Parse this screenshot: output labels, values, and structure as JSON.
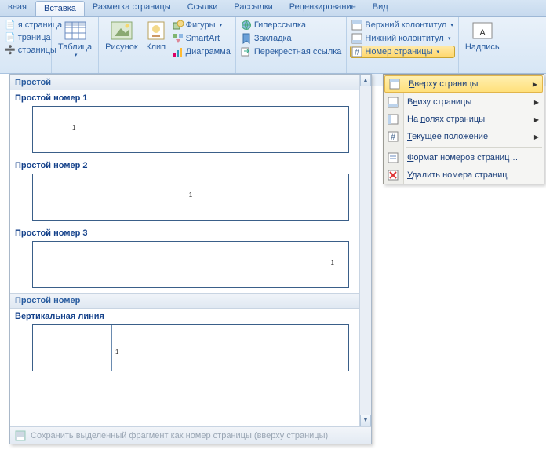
{
  "tabs": [
    "вная",
    "Вставка",
    "Разметка страницы",
    "Ссылки",
    "Рассылки",
    "Рецензирование",
    "Вид"
  ],
  "active_tab": 1,
  "ribbon": {
    "pages": {
      "cover": "я страница",
      "blank": "траница",
      "break": "страницы"
    },
    "table": "Таблица",
    "illus": {
      "picture": "Рисунок",
      "clip": "Клип",
      "shapes": "Фигуры",
      "smartart": "SmartArt",
      "chart": "Диаграмма"
    },
    "links": {
      "hyper": "Гиперссылка",
      "bookmark": "Закладка",
      "cross": "Перекрестная ссылка"
    },
    "hf": {
      "header": "Верхний колонтитул",
      "footer": "Нижний колонтитул",
      "pagenum": "Номер страницы"
    },
    "text": {
      "textbox": "Надпись"
    }
  },
  "menu": {
    "items": [
      {
        "label": "Вверху страницы",
        "u": 0,
        "arr": true,
        "hl": true
      },
      {
        "label": "Внизу страницы",
        "u": 1,
        "arr": true
      },
      {
        "label": "На полях страницы",
        "u": 3,
        "arr": true
      },
      {
        "label": "Текущее положение",
        "u": 0,
        "arr": true
      }
    ],
    "items2": [
      {
        "label": "Формат номеров страниц…",
        "u": 0
      },
      {
        "label": "Удалить номера страниц",
        "u": 0
      }
    ]
  },
  "gallery": {
    "hdr1": "Простой",
    "t1": "Простой номер 1",
    "t2": "Простой номер 2",
    "t3": "Простой номер 3",
    "hdr2": "Простой номер",
    "t4": "Вертикальная линия",
    "pn": "1",
    "footer": "Сохранить выделенный фрагмент как номер страницы (вверху страницы)"
  }
}
